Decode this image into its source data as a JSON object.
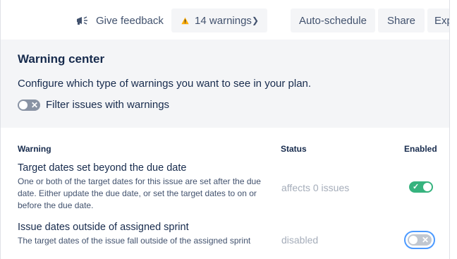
{
  "toolbar": {
    "feedback_label": "Give feedback",
    "feedback_icon": "megaphone-icon",
    "warnings_label": "14 warnings",
    "warnings_icon": "warning-icon",
    "warnings_color": "#ffab00",
    "auto_schedule_label": "Auto-schedule",
    "share_label": "Share",
    "export_label": "Exp"
  },
  "warning_center": {
    "title": "Warning center",
    "description": "Configure which type of warnings you want to see in your plan.",
    "filter_label": "Filter issues with warnings",
    "filter_enabled": false
  },
  "table": {
    "columns": {
      "warning": "Warning",
      "status": "Status",
      "enabled": "Enabled"
    },
    "rows": [
      {
        "title": "Target dates set beyond the due date",
        "description": "One or both of the target dates for this issue are set after the due date. Either update the due date, or set the target dates to on or before the due date.",
        "status": "affects 0 issues",
        "enabled": true
      },
      {
        "title": "Issue dates outside of assigned sprint",
        "description": "The target dates of the issue fall outside of the assigned sprint",
        "status": "disabled",
        "enabled": false
      }
    ]
  },
  "colors": {
    "toggle_on": "#36b37e",
    "focus_ring": "#4c9aff",
    "panel_bg": "#f4f5f7"
  }
}
